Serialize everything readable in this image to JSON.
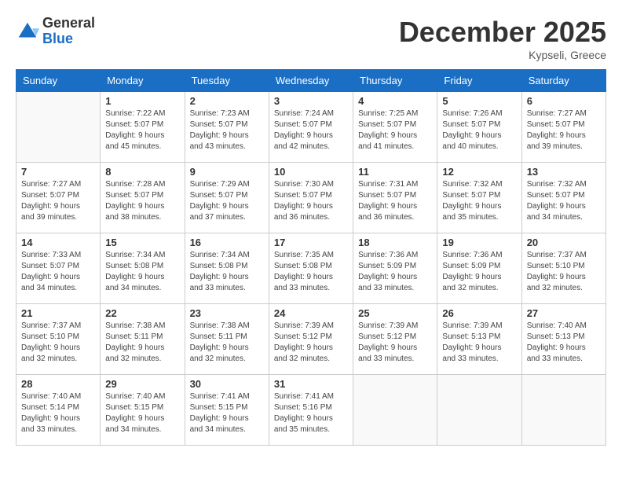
{
  "header": {
    "logo": {
      "general": "General",
      "blue": "Blue"
    },
    "title": "December 2025",
    "location": "Kypseli, Greece"
  },
  "weekdays": [
    "Sunday",
    "Monday",
    "Tuesday",
    "Wednesday",
    "Thursday",
    "Friday",
    "Saturday"
  ],
  "weeks": [
    [
      {
        "day": "",
        "info": ""
      },
      {
        "day": "1",
        "info": "Sunrise: 7:22 AM\nSunset: 5:07 PM\nDaylight: 9 hours\nand 45 minutes."
      },
      {
        "day": "2",
        "info": "Sunrise: 7:23 AM\nSunset: 5:07 PM\nDaylight: 9 hours\nand 43 minutes."
      },
      {
        "day": "3",
        "info": "Sunrise: 7:24 AM\nSunset: 5:07 PM\nDaylight: 9 hours\nand 42 minutes."
      },
      {
        "day": "4",
        "info": "Sunrise: 7:25 AM\nSunset: 5:07 PM\nDaylight: 9 hours\nand 41 minutes."
      },
      {
        "day": "5",
        "info": "Sunrise: 7:26 AM\nSunset: 5:07 PM\nDaylight: 9 hours\nand 40 minutes."
      },
      {
        "day": "6",
        "info": "Sunrise: 7:27 AM\nSunset: 5:07 PM\nDaylight: 9 hours\nand 39 minutes."
      }
    ],
    [
      {
        "day": "7",
        "info": "Sunrise: 7:27 AM\nSunset: 5:07 PM\nDaylight: 9 hours\nand 39 minutes."
      },
      {
        "day": "8",
        "info": "Sunrise: 7:28 AM\nSunset: 5:07 PM\nDaylight: 9 hours\nand 38 minutes."
      },
      {
        "day": "9",
        "info": "Sunrise: 7:29 AM\nSunset: 5:07 PM\nDaylight: 9 hours\nand 37 minutes."
      },
      {
        "day": "10",
        "info": "Sunrise: 7:30 AM\nSunset: 5:07 PM\nDaylight: 9 hours\nand 36 minutes."
      },
      {
        "day": "11",
        "info": "Sunrise: 7:31 AM\nSunset: 5:07 PM\nDaylight: 9 hours\nand 36 minutes."
      },
      {
        "day": "12",
        "info": "Sunrise: 7:32 AM\nSunset: 5:07 PM\nDaylight: 9 hours\nand 35 minutes."
      },
      {
        "day": "13",
        "info": "Sunrise: 7:32 AM\nSunset: 5:07 PM\nDaylight: 9 hours\nand 34 minutes."
      }
    ],
    [
      {
        "day": "14",
        "info": "Sunrise: 7:33 AM\nSunset: 5:07 PM\nDaylight: 9 hours\nand 34 minutes."
      },
      {
        "day": "15",
        "info": "Sunrise: 7:34 AM\nSunset: 5:08 PM\nDaylight: 9 hours\nand 34 minutes."
      },
      {
        "day": "16",
        "info": "Sunrise: 7:34 AM\nSunset: 5:08 PM\nDaylight: 9 hours\nand 33 minutes."
      },
      {
        "day": "17",
        "info": "Sunrise: 7:35 AM\nSunset: 5:08 PM\nDaylight: 9 hours\nand 33 minutes."
      },
      {
        "day": "18",
        "info": "Sunrise: 7:36 AM\nSunset: 5:09 PM\nDaylight: 9 hours\nand 33 minutes."
      },
      {
        "day": "19",
        "info": "Sunrise: 7:36 AM\nSunset: 5:09 PM\nDaylight: 9 hours\nand 32 minutes."
      },
      {
        "day": "20",
        "info": "Sunrise: 7:37 AM\nSunset: 5:10 PM\nDaylight: 9 hours\nand 32 minutes."
      }
    ],
    [
      {
        "day": "21",
        "info": "Sunrise: 7:37 AM\nSunset: 5:10 PM\nDaylight: 9 hours\nand 32 minutes."
      },
      {
        "day": "22",
        "info": "Sunrise: 7:38 AM\nSunset: 5:11 PM\nDaylight: 9 hours\nand 32 minutes."
      },
      {
        "day": "23",
        "info": "Sunrise: 7:38 AM\nSunset: 5:11 PM\nDaylight: 9 hours\nand 32 minutes."
      },
      {
        "day": "24",
        "info": "Sunrise: 7:39 AM\nSunset: 5:12 PM\nDaylight: 9 hours\nand 32 minutes."
      },
      {
        "day": "25",
        "info": "Sunrise: 7:39 AM\nSunset: 5:12 PM\nDaylight: 9 hours\nand 33 minutes."
      },
      {
        "day": "26",
        "info": "Sunrise: 7:39 AM\nSunset: 5:13 PM\nDaylight: 9 hours\nand 33 minutes."
      },
      {
        "day": "27",
        "info": "Sunrise: 7:40 AM\nSunset: 5:13 PM\nDaylight: 9 hours\nand 33 minutes."
      }
    ],
    [
      {
        "day": "28",
        "info": "Sunrise: 7:40 AM\nSunset: 5:14 PM\nDaylight: 9 hours\nand 33 minutes."
      },
      {
        "day": "29",
        "info": "Sunrise: 7:40 AM\nSunset: 5:15 PM\nDaylight: 9 hours\nand 34 minutes."
      },
      {
        "day": "30",
        "info": "Sunrise: 7:41 AM\nSunset: 5:15 PM\nDaylight: 9 hours\nand 34 minutes."
      },
      {
        "day": "31",
        "info": "Sunrise: 7:41 AM\nSunset: 5:16 PM\nDaylight: 9 hours\nand 35 minutes."
      },
      {
        "day": "",
        "info": ""
      },
      {
        "day": "",
        "info": ""
      },
      {
        "day": "",
        "info": ""
      }
    ]
  ]
}
